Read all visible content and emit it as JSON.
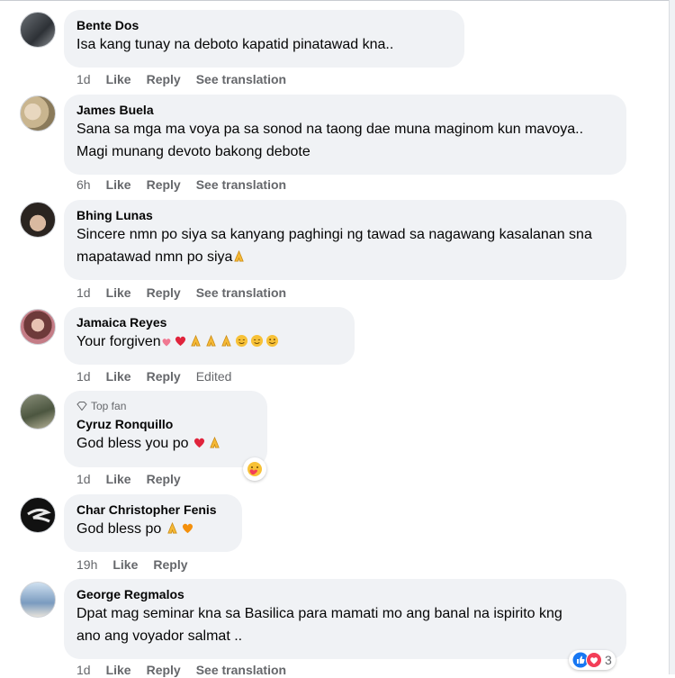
{
  "comments": [
    {
      "author": "Bente Dos",
      "text": "Isa kang tunay na deboto kapatid pinatawad kna..",
      "time": "1d",
      "actions": [
        "Like",
        "Reply",
        "See translation"
      ]
    },
    {
      "author": "James Buela",
      "text": "Sana sa mga ma voya pa sa sonod na taong dae muna maginom kun mavoya.. Magi munang devoto bakong debote",
      "time": "6h",
      "actions": [
        "Like",
        "Reply",
        "See translation"
      ]
    },
    {
      "author": "Bhing Lunas",
      "text": "Sincere nmn po siya sa kanyang paghingi ng tawad sa nagawang kasalanan sna mapatawad nmn po siya",
      "time": "1d",
      "actions": [
        "Like",
        "Reply",
        "See translation"
      ]
    },
    {
      "author": "Jamaica Reyes",
      "text": "Your forgiven",
      "time": "1d",
      "actions": [
        "Like",
        "Reply",
        "Edited"
      ]
    },
    {
      "author": "Cyruz Ronquillo",
      "badge": "Top fan",
      "text": "God bless you po",
      "time": "1d",
      "actions": [
        "Like",
        "Reply"
      ]
    },
    {
      "author": "Char Christopher Fenis",
      "text": "God bless po",
      "time": "19h",
      "actions": [
        "Like",
        "Reply"
      ]
    },
    {
      "author": "George Regmalos",
      "text": "Dpat mag seminar kna sa Basilica para mamati mo ang banal na ispirito kng ano ang voyador salmat ..",
      "time": "1d",
      "actions": [
        "Like",
        "Reply",
        "See translation"
      ]
    }
  ],
  "reactions": {
    "count": "3",
    "icons": [
      "like-icon",
      "love-icon"
    ]
  },
  "colors": {
    "bubble": "#f0f2f5",
    "meta": "#65676b",
    "like": "#1877f2",
    "love": "#f33e58"
  }
}
